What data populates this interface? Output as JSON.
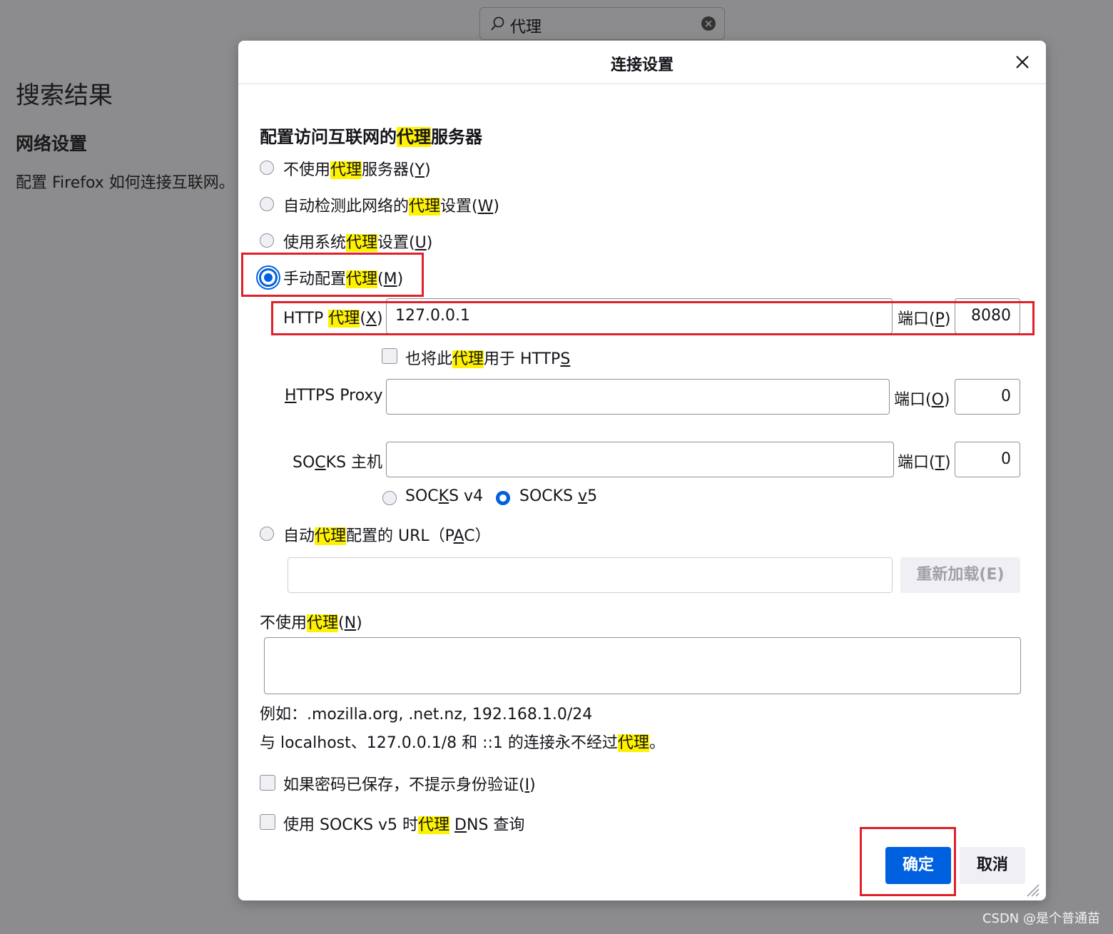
{
  "background": {
    "search_query": "代理",
    "heading": "搜索结果",
    "subheading": "网络设置",
    "description": "配置 Firefox 如何连接互联网。"
  },
  "dialog": {
    "title": "连接设置",
    "section_title": {
      "pre": "配置访问互联网的",
      "hl": "代理",
      "post": "服务器"
    },
    "options": {
      "no_proxy": {
        "pre": "不使用",
        "hl": "代理",
        "post": "服务器(",
        "key": "Y",
        "end": ")"
      },
      "auto_detect": {
        "pre": "自动检测此网络的",
        "hl": "代理",
        "post": "设置(",
        "key": "W",
        "end": ")"
      },
      "system": {
        "pre": "使用系统",
        "hl": "代理",
        "post": "设置(",
        "key": "U",
        "end": ")"
      },
      "manual": {
        "pre": "手动配置",
        "hl": "代理",
        "post": "(",
        "key": "M",
        "end": ")"
      },
      "pac": {
        "pre": "自动",
        "hl": "代理",
        "post": "配置的 URL（P",
        "key": "A",
        "end": "C）"
      }
    },
    "selected_option": "manual",
    "http": {
      "label_pre": "HTTP ",
      "label_hl": "代理",
      "label_post": "(",
      "key": "X",
      "end": ")",
      "value": "127.0.0.1",
      "port_label_pre": "端口(",
      "port_key": "P",
      "port_end": ")",
      "port": "8080"
    },
    "also_https": {
      "pre": "也将此",
      "hl": "代理",
      "post": "用于 HTTP",
      "key": "S"
    },
    "https": {
      "key": "H",
      "label_rest": "TTPS Proxy",
      "value": "",
      "port_label_pre": "端口(",
      "port_key": "O",
      "port_end": ")",
      "port": "0"
    },
    "socks": {
      "label_pre": "SO",
      "key": "C",
      "label_post": "KS 主机",
      "value": "",
      "port_label_pre": "端口(",
      "port_key": "T",
      "port_end": ")",
      "port": "0"
    },
    "socks_v4": {
      "pre": "SOC",
      "key": "K",
      "post": "S v4"
    },
    "socks_v5": {
      "pre": "SOCKS ",
      "key": "v",
      "post": "5"
    },
    "socks_version": "v5",
    "pac_url": "",
    "reload_label": "重新加载(E)",
    "no_proxy_for": {
      "pre": "不使用",
      "hl": "代理",
      "post": "(",
      "key": "N",
      "end": ")",
      "value": ""
    },
    "example": "例如：.mozilla.org, .net.nz, 192.168.1.0/24",
    "note": {
      "pre": "与 localhost、127.0.0.1/8 和 ::1 的连接永不经过",
      "hl": "代理",
      "post": "。"
    },
    "no_auth_prompt": {
      "pre": "如果密码已保存，不提示身份验证(",
      "key": "I",
      "end": ")"
    },
    "socks_dns": {
      "pre": "使用 SOCKS v5 时",
      "hl": "代理",
      "post": " ",
      "key": "D",
      "end": "NS 查询"
    },
    "ok_label": "确定",
    "cancel_label": "取消"
  },
  "watermark": "CSDN @是个普通苗",
  "colors": {
    "accent": "#0061e0",
    "highlight": "#fff200",
    "annotation_red": "#e0202a",
    "overlay": "#8c8c8f"
  }
}
